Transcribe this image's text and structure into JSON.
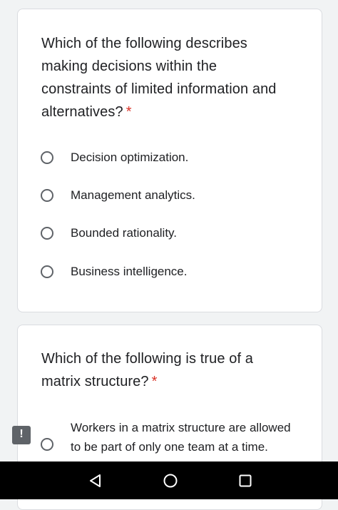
{
  "required_marker": "*",
  "questions": [
    {
      "text": "Which of the following describes making decisions within the constraints of limited information and alternatives?",
      "options": [
        "Decision optimization.",
        "Management analytics.",
        "Bounded rationality.",
        "Business intelligence."
      ]
    },
    {
      "text": "Which of the following is true of a matrix structure?",
      "options": [
        "Workers in a matrix structure are allowed to be part of only one team at a time."
      ]
    }
  ],
  "feedback_button": {
    "label": "!",
    "icon": "report-icon"
  },
  "navbar": {
    "back_icon": "back-triangle-icon",
    "home_icon": "home-circle-icon",
    "recents_icon": "recents-square-icon"
  },
  "colors": {
    "background": "#f1f3f4",
    "card": "#ffffff",
    "required": "#d93025",
    "radio_border": "#5f6368",
    "navbar": "#000000"
  }
}
